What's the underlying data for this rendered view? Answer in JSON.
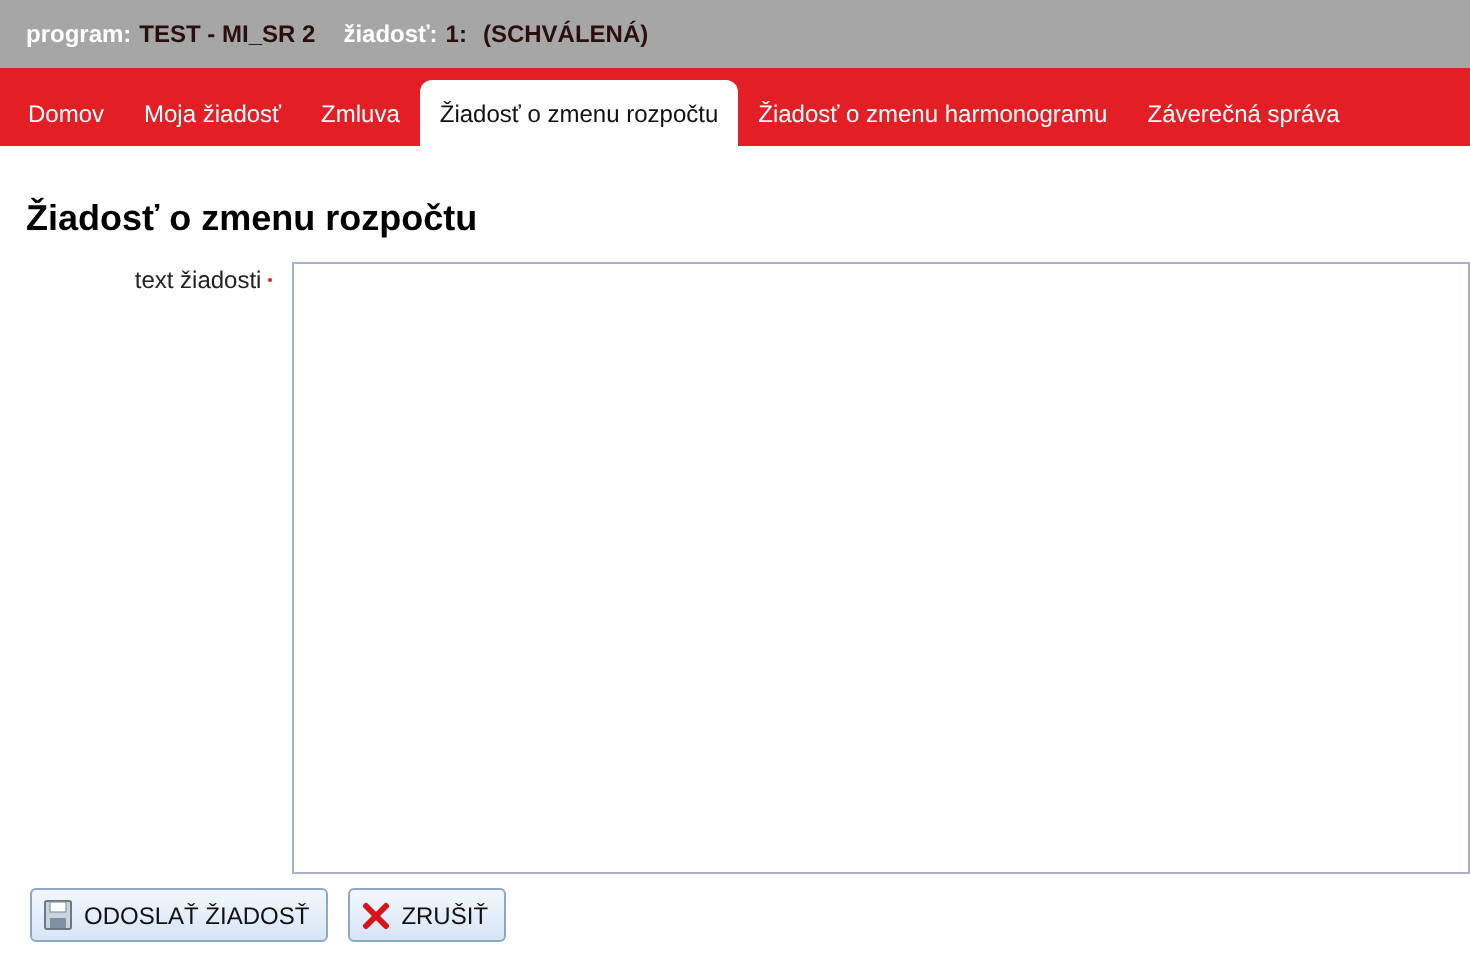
{
  "header": {
    "program_label": "program:",
    "program_value": "TEST - MI_SR 2",
    "request_label": "žiadosť:",
    "request_number": "1:",
    "request_status": "(SCHVÁLENÁ)"
  },
  "tabs": [
    {
      "label": "Domov",
      "selected": false
    },
    {
      "label": "Moja žiadosť",
      "selected": false
    },
    {
      "label": "Zmluva",
      "selected": false
    },
    {
      "label": "Žiadosť o zmenu rozpočtu",
      "selected": true
    },
    {
      "label": "Žiadosť o zmenu harmonogramu",
      "selected": false
    },
    {
      "label": "Záverečná správa",
      "selected": false
    }
  ],
  "page_title": "Žiadosť o zmenu rozpočtu",
  "form": {
    "fields": [
      {
        "label": "text žiadosti",
        "required": true
      }
    ]
  },
  "buttons": [
    {
      "label": "ODOSLAŤ ŽIADOSŤ",
      "kind": "save"
    },
    {
      "label": "ZRUŠIŤ",
      "kind": "cancel"
    }
  ]
}
